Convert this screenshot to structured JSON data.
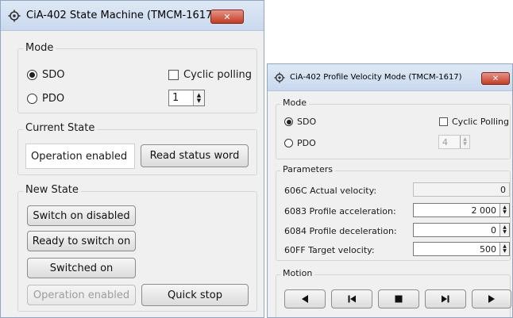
{
  "state_machine": {
    "title": "CiA-402 State Machine (TMCM-1617)",
    "close_glyph": "✕",
    "mode": {
      "legend": "Mode",
      "sdo_label": "SDO",
      "pdo_label": "PDO",
      "selected": "SDO",
      "cyclic_label": "Cyclic polling",
      "cyclic_checked": false,
      "interval": "1"
    },
    "current_state": {
      "legend": "Current State",
      "value": "Operation enabled",
      "read_button": "Read status word"
    },
    "new_state": {
      "legend": "New State",
      "buttons": [
        "Switch on disabled",
        "Ready to switch on",
        "Switched on",
        "Operation enabled",
        "Quick stop"
      ]
    }
  },
  "profile_velocity": {
    "title": "CiA-402 Profile Velocity Mode (TMCM-1617)",
    "close_glyph": "✕",
    "mode": {
      "legend": "Mode",
      "sdo_label": "SDO",
      "pdo_label": "PDO",
      "selected": "SDO",
      "cyclic_label": "Cyclic Polling",
      "cyclic_checked": false,
      "interval": "4"
    },
    "parameters": {
      "legend": "Parameters",
      "rows": [
        {
          "label": "606C  Actual velocity:",
          "value": "0"
        },
        {
          "label": "6083  Profile acceleration:",
          "value": "2 000"
        },
        {
          "label": "6084  Profile deceleration:",
          "value": "0"
        },
        {
          "label": "60FF  Target velocity:",
          "value": "500"
        }
      ]
    },
    "motion": {
      "legend": "Motion",
      "icons": [
        "play-left-icon",
        "skip-to-start-icon",
        "stop-icon",
        "skip-to-end-icon",
        "play-right-icon"
      ]
    }
  },
  "icons": {
    "title": "gear-icon",
    "spinner_up": "▲",
    "spinner_down": "▼"
  },
  "colors": {
    "window_bg": "#f0f0f0",
    "titlebar": "#c9d9ee",
    "close_button": "#c53b23"
  }
}
